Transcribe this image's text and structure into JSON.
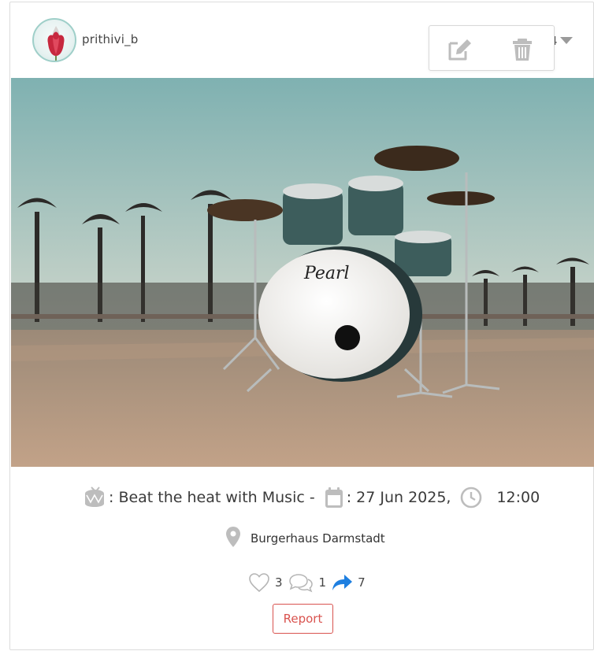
{
  "post": {
    "author": {
      "username": "prithivi_b",
      "avatar_icon": "tulip-avatar"
    },
    "header_counter": "4",
    "menu": {
      "edit_icon": "edit-icon",
      "delete_icon": "trash-icon"
    },
    "image": {
      "description_icon": "drum-kit-photo"
    },
    "event": {
      "title": ": Beat the heat with Music -",
      "date": ": 27 Jun 2025,",
      "time": "12:00",
      "location": "Burgerhaus Darmstadt"
    },
    "stats": {
      "likes": "3",
      "comments": "1",
      "shares": "7"
    },
    "report_label": "Report"
  },
  "colors": {
    "accent_blue": "#1e7fe0",
    "report_red": "#d9534f",
    "icon_gray": "#bdbdbd"
  }
}
